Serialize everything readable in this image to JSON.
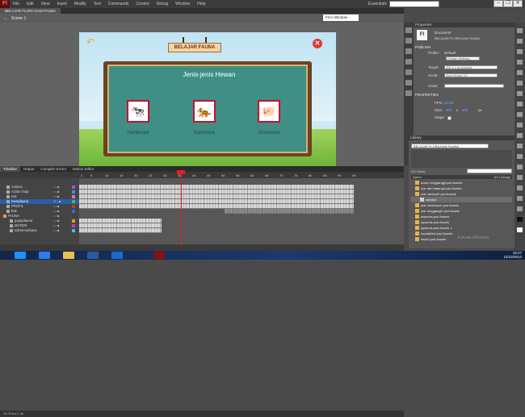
{
  "app": {
    "logo": "Fl"
  },
  "menu": [
    "File",
    "Edit",
    "View",
    "Insert",
    "Modify",
    "Text",
    "Commands",
    "Control",
    "Debug",
    "Window",
    "Help"
  ],
  "workspace": "Essentials",
  "window_controls": [
    "–",
    "❐",
    "✕"
  ],
  "document_tab": "BELAJAR FLORA DAN FAUNA",
  "scene": "Scene 1",
  "zoom": "Fit in Window",
  "stage": {
    "top_sign": "BELAJAR FAUNA",
    "heading": "Jenis-jenis Hewan",
    "animals": [
      {
        "label": "Herbivora",
        "emoji": "🐄"
      },
      {
        "label": "Karnivora",
        "emoji": "🐅"
      },
      {
        "label": "Omnivora",
        "emoji": "🐖"
      }
    ],
    "back_icon": "↶",
    "close_icon": "✕"
  },
  "properties": {
    "tab": "Properties",
    "doc_type": "Document",
    "doc_name": "BELAJAR FLORA DAN FAUNA",
    "publish_header": "PUBLISH",
    "profile_label": "Profile:",
    "profile_value": "Default",
    "publish_settings": "Publish Settings...",
    "target_label": "Target:",
    "target_value": "AIR 3.2 for Android",
    "script_label": "Script:",
    "script_value": "ActionScript 3.0",
    "class_label": "Class:",
    "props_header": "PROPERTIES",
    "fps_label": "FPS:",
    "fps_value": "24.00",
    "size_label": "Size:",
    "size_w": "800",
    "size_x": "x",
    "size_h": "480",
    "size_unit": "px",
    "stage_label": "Stage:"
  },
  "library": {
    "tab": "Library",
    "selected_doc": "BELAJAR FLORA DAN FAUNA",
    "count": "910 items",
    "col_name": "Name",
    "col_linkage": "AS Linkage",
    "items": [
      {
        "name": "ducer tungganggi.psd Assets"
      },
      {
        "name": "ular dan batang2.psd Assets"
      },
      {
        "name": "ular sarabut2.psd Assets"
      },
      {
        "name": "sarabut"
      },
      {
        "name": "ular sarabusuh.psd Assets"
      },
      {
        "name": "ular tunggangi2.psd Assets"
      },
      {
        "name": "alsavers.psd Assets"
      },
      {
        "name": "ayasmis.psd Assets"
      },
      {
        "name": "ayasmis.psd Assets 1"
      },
      {
        "name": "bantabbb4.psd Assets"
      },
      {
        "name": "back2.psd Assets"
      }
    ]
  },
  "timeline": {
    "tabs": [
      "Timeline",
      "Output",
      "Compiler Errors",
      "Motion Editor"
    ],
    "frame_numbers": [
      "1",
      "5",
      "10",
      "15",
      "20",
      "25",
      "30",
      "35",
      "40",
      "45",
      "50",
      "55",
      "60",
      "65",
      "70",
      "75",
      "80",
      "85",
      "90",
      "95"
    ],
    "layers": [
      {
        "name": "Actions"
      },
      {
        "name": "Action Stop"
      },
      {
        "name": "exit"
      },
      {
        "name": "menufauna"
      },
      {
        "name": "PROFIL"
      },
      {
        "name": "buk"
      },
      {
        "name": "FAUNA"
      },
      {
        "name": "popupfauna"
      },
      {
        "name": "MATERI"
      },
      {
        "name": "submenufauna"
      }
    ],
    "footer": "24.00 fps   1.4s"
  },
  "watermark": "Activate Windows",
  "tray": {
    "time": "18:27",
    "date": "12/12/2014"
  },
  "colors": {
    "accent": "#c8102e",
    "selection": "#2b5da8",
    "playhead": "#e02020"
  }
}
